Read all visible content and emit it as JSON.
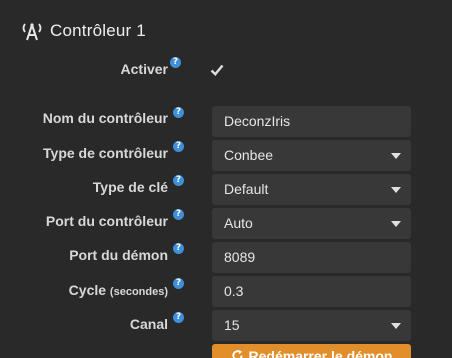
{
  "section": {
    "title": "Contrôleur 1",
    "icon": "antenna-icon"
  },
  "fields": {
    "activer": {
      "label": "Activer",
      "checked": true,
      "help_icon": "question-icon"
    },
    "nom": {
      "label": "Nom du contrôleur",
      "value": "DeconzIris"
    },
    "type_controleur": {
      "label": "Type de contrôleur",
      "value": "Conbee"
    },
    "type_cle": {
      "label": "Type de clé",
      "value": "Default"
    },
    "port_controleur": {
      "label": "Port du contrôleur",
      "value": "Auto"
    },
    "port_demon": {
      "label": "Port du démon",
      "value": "8089"
    },
    "cycle": {
      "label": "Cycle",
      "label_suffix": "(secondes)",
      "value": "0.3"
    },
    "canal": {
      "label": "Canal",
      "value": "15"
    }
  },
  "help_glyph": "?",
  "actions": {
    "restart_label": "Redémarrer le démon"
  },
  "colors": {
    "background": "#292929",
    "field": "#383838",
    "help": "#3f8fd9",
    "button": "#e18f2a"
  }
}
